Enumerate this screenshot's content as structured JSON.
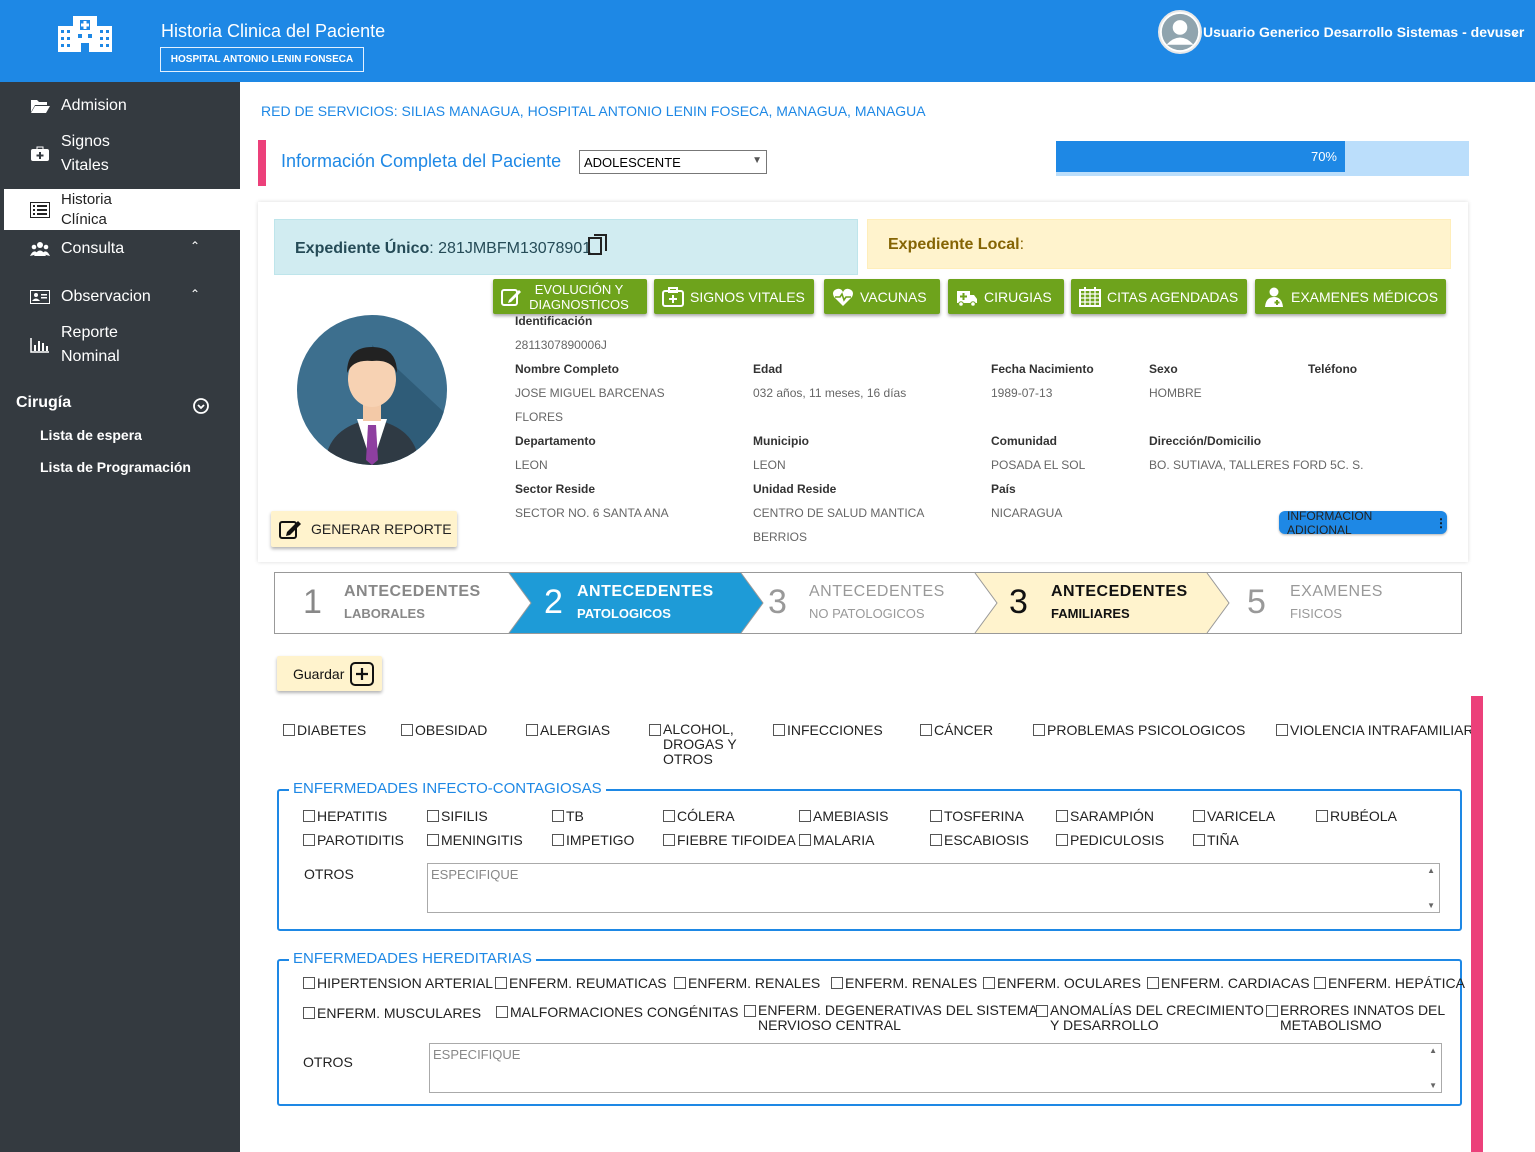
{
  "header": {
    "title": "Historia Clinica del Paciente",
    "hospital": "HOSPITAL ANTONIO LENIN FONSECA",
    "user": "Usuario Generico Desarrollo Sistemas - devuser"
  },
  "sidebar": {
    "items": [
      {
        "label": "Admision",
        "icon": "folder-open-icon"
      },
      {
        "label": "Signos Vitales",
        "icon": "medkit-icon"
      },
      {
        "label": "Historia Clínica",
        "icon": "list-icon"
      },
      {
        "label": "Consulta",
        "icon": "users-icon"
      },
      {
        "label": "Observacion",
        "icon": "id-card-icon"
      },
      {
        "label": "Reporte Nominal",
        "icon": "bar-chart-icon"
      }
    ],
    "section": "Cirugía",
    "sub_items": [
      "Lista de espera",
      "Lista de Programación"
    ]
  },
  "main": {
    "red": "RED DE SERVICIOS: SILIAS MANAGUA, HOSPITAL ANTONIO LENIN FOSECA, MANAGUA, MANAGUA",
    "info_title": "Información Completa del Paciente",
    "age_group": "ADOLESCENTE",
    "progress_label": "70%",
    "progress": 0.7,
    "exp_unico_label": "Expediente Único",
    "exp_unico_value": ": 281JMBFM13078901",
    "exp_local_label": "Expediente Local",
    "exp_local_colon": ":"
  },
  "actions": [
    "EVOLUCIÓN Y DIAGNOSTICOS",
    "SIGNOS VITALES",
    "VACUNAS",
    "CIRUGIAS",
    "CITAS AGENDADAS",
    "EXAMENES MÉDICOS"
  ],
  "patient": {
    "id_label": "Identificación",
    "id": "2811307890006J",
    "name_label": "Nombre Completo",
    "name1": "JOSE MIGUEL BARCENAS",
    "name2": "FLORES",
    "age_label": "Edad",
    "age": "032 años, 11 meses, 16 días",
    "dob_label": "Fecha Nacimiento",
    "dob": "1989-07-13",
    "sex_label": "Sexo",
    "sex": "HOMBRE",
    "phone_label": "Teléfono",
    "dept_label": "Departamento",
    "dept": "LEON",
    "mun_label": "Municipio",
    "mun": "LEON",
    "com_label": "Comunidad",
    "com": "POSADA EL SOL",
    "addr_label": "Dirección/Domicilio",
    "addr": "BO. SUTIAVA, TALLERES FORD 5C. S.",
    "sector_label": "Sector Reside",
    "sector": "SECTOR NO. 6 SANTA ANA",
    "unit_label": "Unidad Reside",
    "unit1": "CENTRO DE SALUD MANTICA",
    "unit2": "BERRIOS",
    "country_label": "País",
    "country": "NICARAGUA",
    "report_btn": "GENERAR REPORTE",
    "info_btn": "INFORMACION ADICIONAL"
  },
  "wizard": [
    {
      "num": "1",
      "t1": "ANTECEDENTES",
      "t2": "LABORALES"
    },
    {
      "num": "2",
      "t1": "ANTECEDENTES",
      "t2": "PATOLOGICOS"
    },
    {
      "num": "3",
      "t1": "ANTECEDENTES",
      "t2": "NO PATOLOGICOS"
    },
    {
      "num": "3",
      "t1": "ANTECEDENTES",
      "t2": "FAMILIARES"
    },
    {
      "num": "5",
      "t1": "EXAMENES",
      "t2": "FISICOS"
    }
  ],
  "save_label": "Guardar",
  "conditions": [
    "DIABETES",
    "OBESIDAD",
    "ALERGIAS",
    "ALCOHOL,",
    "DROGAS Y",
    "OTROS",
    "INFECCIONES",
    "CÁNCER",
    "PROBLEMAS PSICOLOGICOS",
    "VIOLENCIA INTRAFAMILIAR"
  ],
  "infect": {
    "legend": "ENFERMEDADES INFECTO-CONTAGIOSAS",
    "row1": [
      "HEPATITIS",
      "SIFILIS",
      "TB",
      "CÓLERA",
      "AMEBIASIS",
      "TOSFERINA",
      "SARAMPIÓN",
      "VARICELA",
      "RUBÉOLA"
    ],
    "row2": [
      "PAROTIDITIS",
      "MENINGITIS",
      "IMPETIGO",
      "FIEBRE TIFOIDEA",
      "MALARIA",
      "ESCABIOSIS",
      "PEDICULOSIS",
      "TIÑA"
    ],
    "otros": "OTROS",
    "placeholder": "ESPECIFIQUE"
  },
  "hered": {
    "legend": "ENFERMEDADES HEREDITARIAS",
    "row1": [
      "HIPERTENSION ARTERIAL",
      "ENFERM. REUMATICAS",
      "ENFERM. RENALES",
      "ENFERM. RENALES",
      "ENFERM. OCULARES",
      "ENFERM. CARDIACAS",
      "ENFERM. HEPÁTICA"
    ],
    "row2": [
      "ENFERM. MUSCULARES",
      "MALFORMACIONES CONGÉNITAS",
      "ENFERM. DEGENERATIVAS DEL SISTEMA",
      "NERVIOSO CENTRAL",
      "ANOMALÍAS DEL CRECIMIENTO",
      "Y DESARROLLO",
      "ERRORES INNATOS DEL",
      "METABOLISMO"
    ],
    "otros": "OTROS",
    "placeholder": "ESPECIFIQUE"
  }
}
